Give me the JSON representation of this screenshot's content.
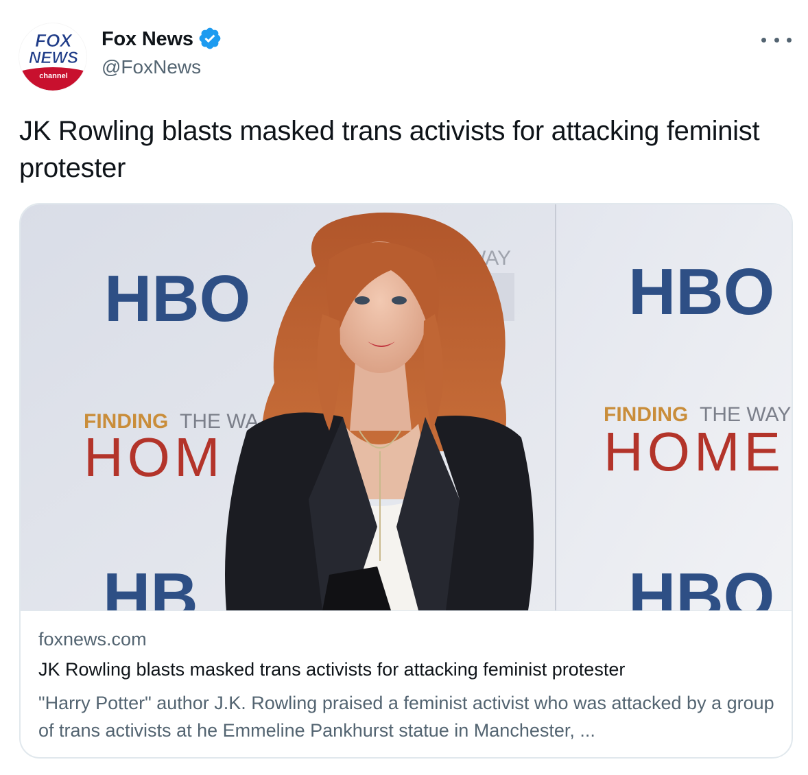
{
  "author": {
    "name": "Fox News",
    "handle": "@FoxNews",
    "verified": true,
    "avatar_logo": {
      "line1": "FOX",
      "line2": "NEWS",
      "line3": "channel"
    }
  },
  "tweet": {
    "text": "JK Rowling blasts masked trans activists for attacking feminist protester"
  },
  "card": {
    "domain": "foxnews.com",
    "title": "JK Rowling blasts masked trans activists for attacking feminist protester",
    "description": "\"Harry Potter\" author J.K. Rowling praised a feminist activist who was attacked by a group of trans activists at he Emmeline Pankhurst statue in Manchester, ...",
    "image": {
      "backdrop_logo": "HBO",
      "backdrop_line1_bold": "FINDING",
      "backdrop_line1_rest": "THE WAY",
      "backdrop_line2": "HOME",
      "partial_left_line1_rest": "THE WA",
      "partial_left_line2": "HOM",
      "partial_bottom_left_logo": "HB",
      "partial_top_center": "WAY"
    }
  },
  "colors": {
    "verified": "#1d9bf0",
    "text_primary": "#0f1419",
    "text_secondary": "#536471",
    "border": "#e1e8ed",
    "hbo_blue": "#2e4f85",
    "home_red": "#b3342a",
    "finding_gold": "#c98d3a"
  },
  "icons": {
    "verified": "verified-badge-icon",
    "more": "more-dots-icon"
  }
}
